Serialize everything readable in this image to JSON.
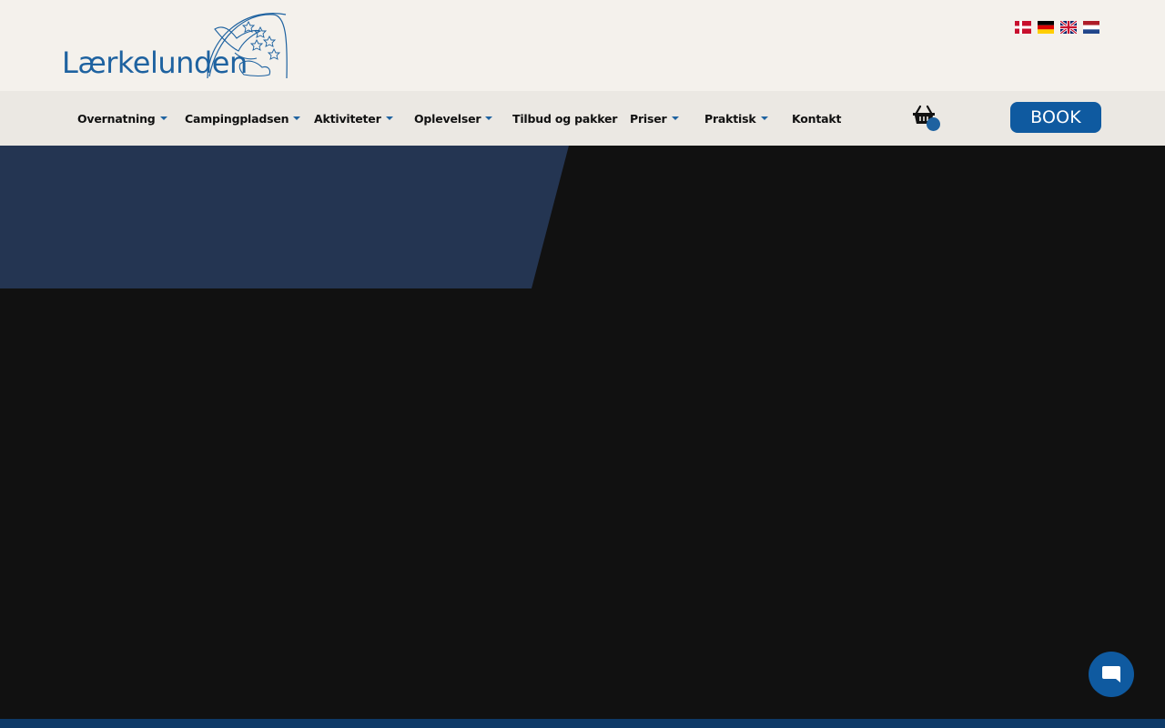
{
  "header": {
    "logo_text": "Lærkelunden",
    "languages": [
      {
        "code": "da",
        "icon": "danish-flag-icon"
      },
      {
        "code": "de",
        "icon": "german-flag-icon"
      },
      {
        "code": "en",
        "icon": "uk-flag-icon"
      },
      {
        "code": "nl",
        "icon": "dutch-flag-icon"
      }
    ]
  },
  "nav": {
    "items": [
      {
        "label": "Overnatning",
        "dropdown": true
      },
      {
        "label": "Campingpladsen",
        "dropdown": true
      },
      {
        "label": "Aktiviteter",
        "dropdown": true
      },
      {
        "label": "Oplevelser",
        "dropdown": true
      },
      {
        "label": "Tilbud og pakker",
        "dropdown": false
      },
      {
        "label": "Priser",
        "dropdown": true
      },
      {
        "label": "Praktisk",
        "dropdown": true
      },
      {
        "label": "Kontakt",
        "dropdown": false
      }
    ],
    "cart_icon": "basket-icon",
    "book_label": "BOOK"
  },
  "chat": {
    "icon": "chat-bubble-icon"
  },
  "colors": {
    "brand_blue": "#0f5aa0",
    "hero_panel": "#243552",
    "header_bg": "#f4f1ec",
    "nav_bg": "#ebe8e3",
    "footer_strip": "#0e3a68"
  }
}
